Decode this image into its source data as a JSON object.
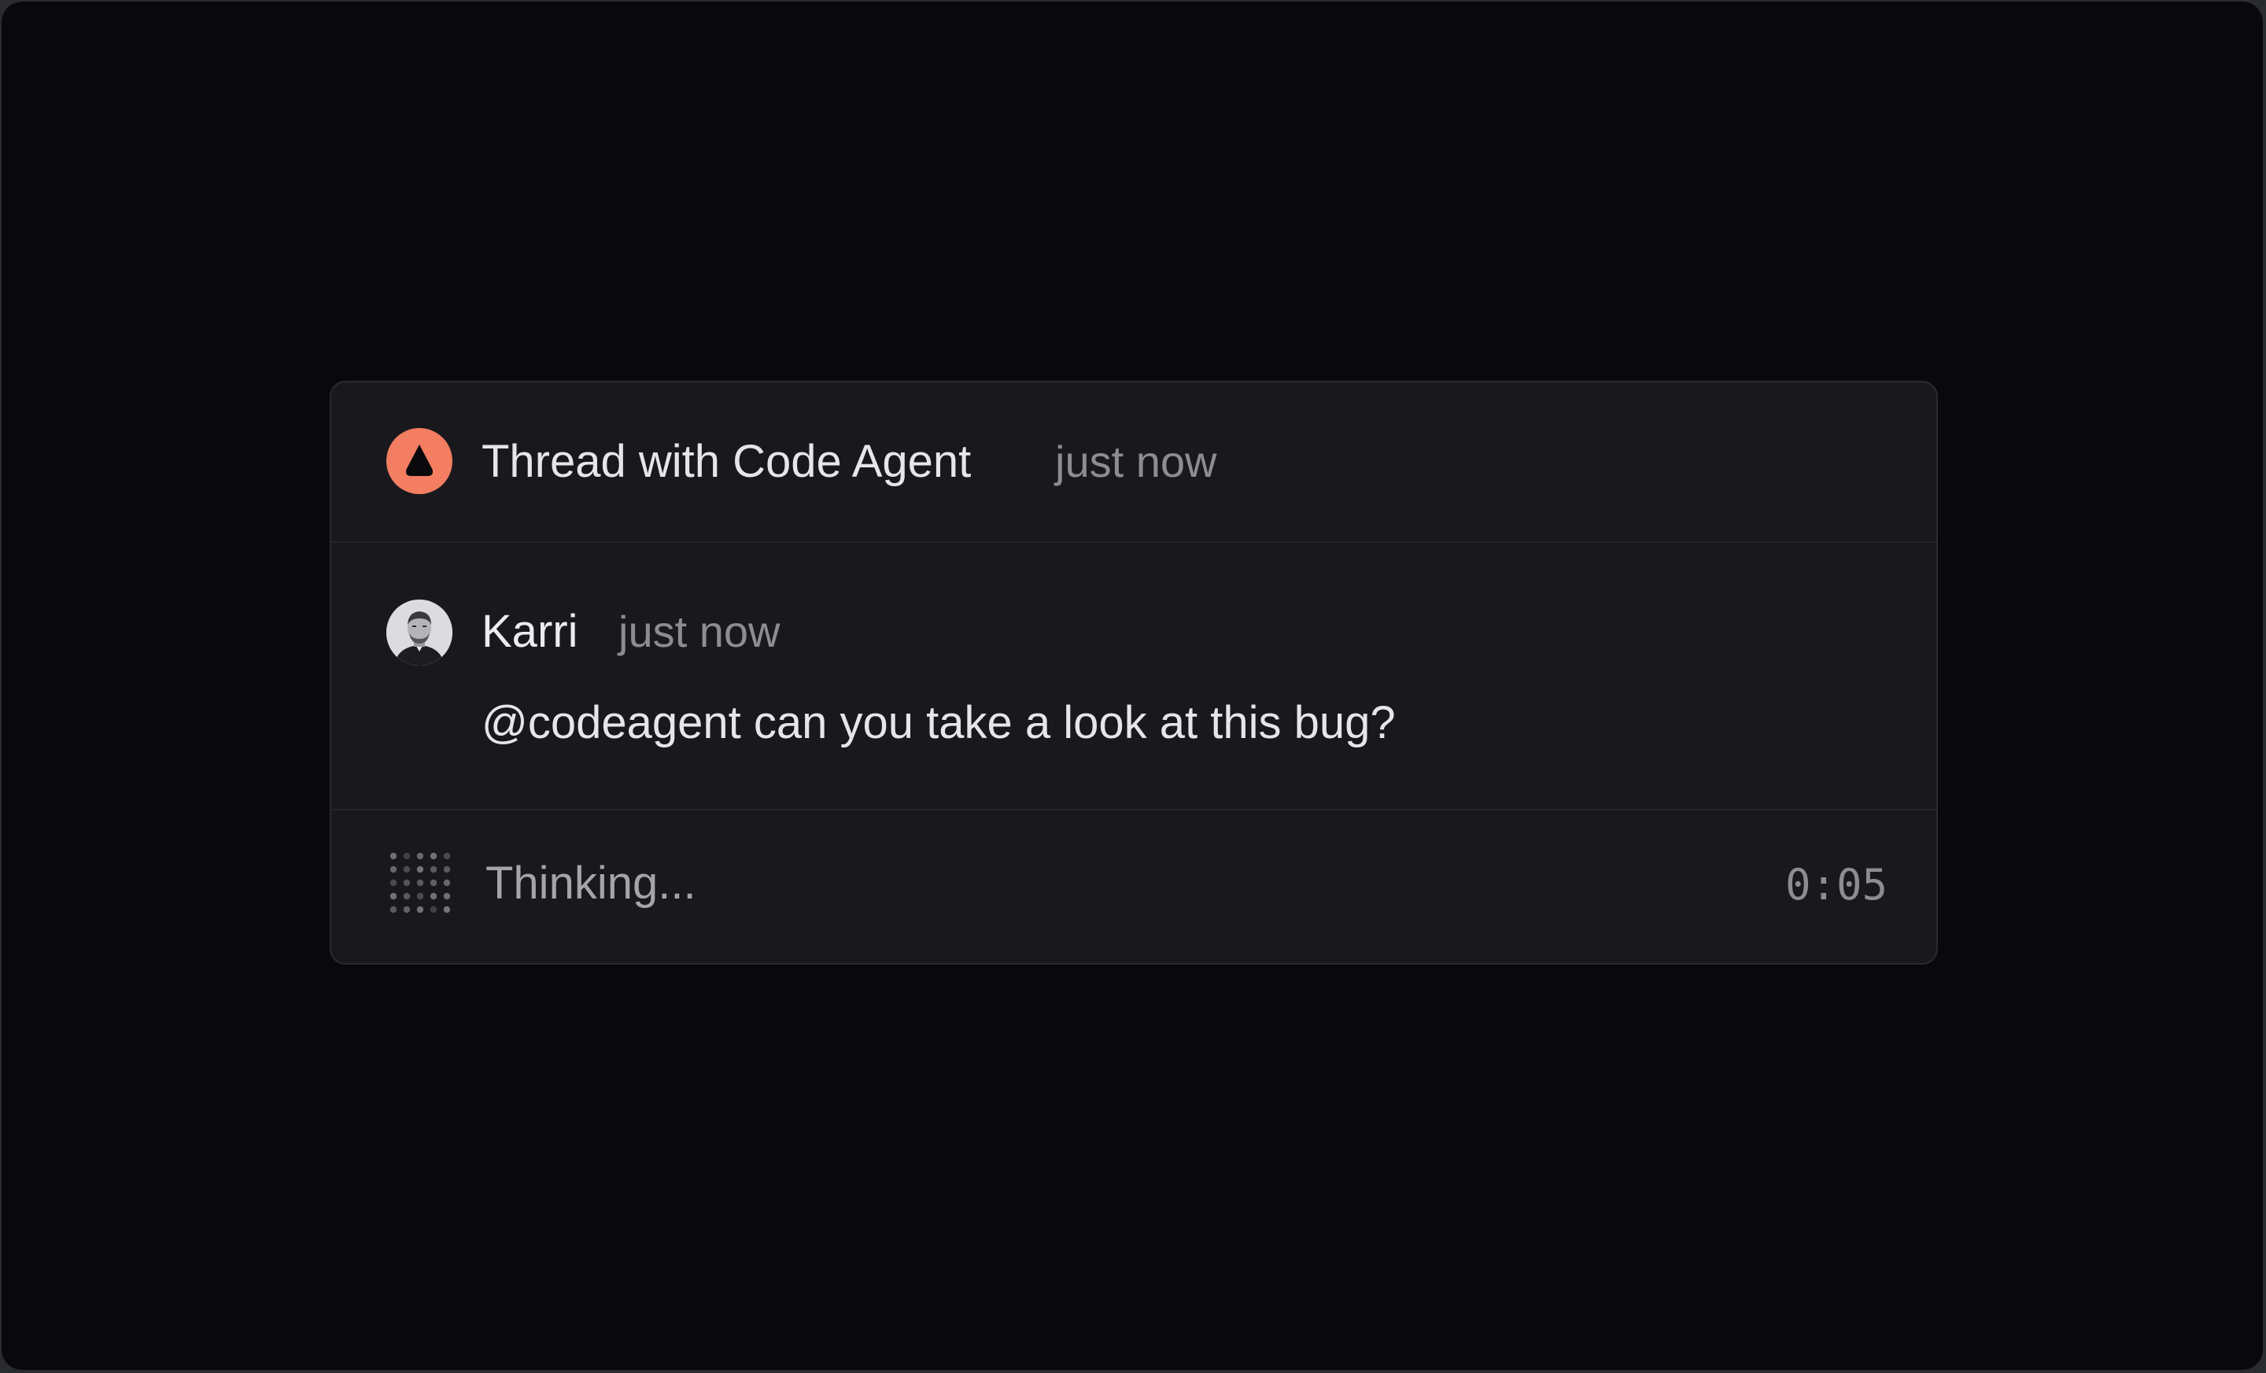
{
  "thread": {
    "agent_icon": "code-agent-logo-icon",
    "title": "Thread with Code Agent",
    "time": "just now"
  },
  "message": {
    "avatar_icon": "user-avatar-photo",
    "author": "Karri",
    "time": "just now",
    "text": "@codeagent can you take a look at this bug?"
  },
  "status": {
    "icon": "thinking-dots-icon",
    "label": "Thinking...",
    "timer": "0:05"
  },
  "colors": {
    "background": "#09090d",
    "card": "#19191d",
    "agent_accent": "#f37e62"
  }
}
